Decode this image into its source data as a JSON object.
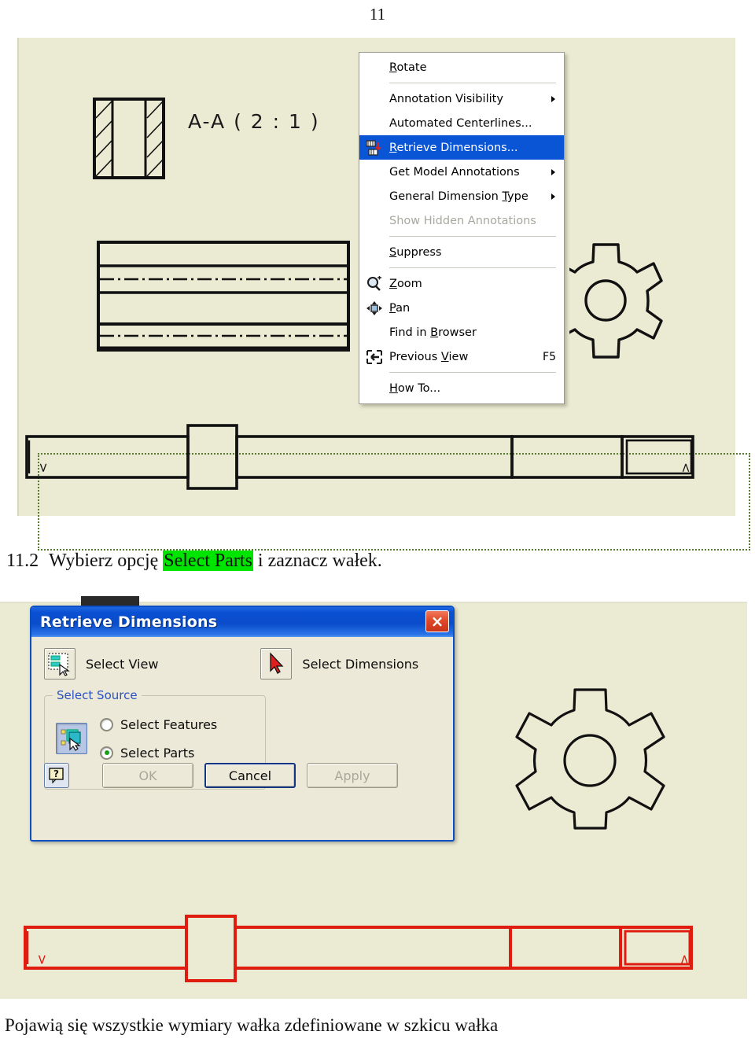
{
  "page": {
    "number": "11"
  },
  "drawing": {
    "section_label": "A-A ( 2 : 1 )",
    "shaft_end_left_marker": ">",
    "shaft_end_right_marker": "<"
  },
  "context_menu": {
    "items": [
      {
        "label": "Rotate",
        "accel": "R",
        "icon": "",
        "state": "normal",
        "submenu": false,
        "shortcut": ""
      },
      {
        "separator": true
      },
      {
        "label": "Annotation Visibility",
        "accel": "",
        "icon": "",
        "state": "normal",
        "submenu": true,
        "shortcut": ""
      },
      {
        "label": "Automated Centerlines...",
        "accel": "",
        "icon": "",
        "state": "normal",
        "submenu": false,
        "shortcut": ""
      },
      {
        "label": "Retrieve Dimensions...",
        "accel": "R",
        "icon": "retrieve-dimensions-icon",
        "state": "highlighted",
        "submenu": false,
        "shortcut": ""
      },
      {
        "label": "Get Model Annotations",
        "accel": "",
        "icon": "",
        "state": "normal",
        "submenu": true,
        "shortcut": ""
      },
      {
        "label": "General Dimension Type",
        "accel": "T",
        "icon": "",
        "state": "normal",
        "submenu": true,
        "shortcut": ""
      },
      {
        "label": "Show Hidden Annotations",
        "accel": "",
        "icon": "",
        "state": "disabled",
        "submenu": false,
        "shortcut": ""
      },
      {
        "separator": true
      },
      {
        "label": "Suppress",
        "accel": "S",
        "icon": "",
        "state": "normal",
        "submenu": false,
        "shortcut": ""
      },
      {
        "separator": true
      },
      {
        "label": "Zoom",
        "accel": "Z",
        "icon": "zoom-icon",
        "state": "normal",
        "submenu": false,
        "shortcut": ""
      },
      {
        "label": "Pan",
        "accel": "P",
        "icon": "pan-icon",
        "state": "normal",
        "submenu": false,
        "shortcut": ""
      },
      {
        "label": "Find in Browser",
        "accel": "B",
        "icon": "",
        "state": "normal",
        "submenu": false,
        "shortcut": ""
      },
      {
        "label": "Previous View",
        "accel": "",
        "icon": "previous-view-icon",
        "state": "normal",
        "submenu": false,
        "shortcut": "F5"
      },
      {
        "separator": true
      },
      {
        "label": "How To...",
        "accel": "H",
        "icon": "",
        "state": "normal",
        "submenu": false,
        "shortcut": ""
      }
    ]
  },
  "dialog": {
    "title": "Retrieve Dimensions",
    "close_label": "×",
    "select_view_label": "Select View",
    "select_dimensions_label": "Select Dimensions",
    "group": {
      "title": "Select Source",
      "options": [
        {
          "label": "Select Features",
          "checked": false
        },
        {
          "label": "Select Parts",
          "checked": true
        }
      ]
    },
    "help_label": "?",
    "buttons": [
      {
        "label": "OK",
        "state": "disabled"
      },
      {
        "label": "Cancel",
        "state": "default"
      },
      {
        "label": "Apply",
        "state": "disabled"
      }
    ]
  },
  "captions": {
    "step_number": "11.2",
    "line1_pre": "Wybierz opcję ",
    "line1_highlight": "Select Parts",
    "line1_post": " i zaznacz wałek.",
    "line2": "Pojawią się wszystkie wymiary wałka zdefiniowane w szkicu wałka"
  },
  "colors": {
    "canvas_bg": "#ebead3",
    "highlight_green": "#00e500",
    "menu_highlight_blue": "#0a55d6",
    "dialog_title_blue": "#0a4ccb",
    "selection_red": "#e01b10",
    "radio_dot_green": "#17a017"
  }
}
